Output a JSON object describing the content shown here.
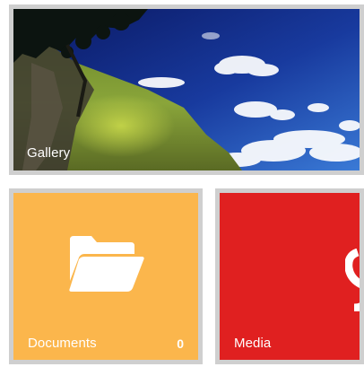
{
  "tiles": {
    "gallery": {
      "label": "Gallery"
    },
    "documents": {
      "label": "Documents",
      "count": "0"
    },
    "media": {
      "label": "Media"
    }
  },
  "colors": {
    "tile_border": "#cfcfcf",
    "documents_bg": "#fbb64c",
    "media_bg": "#e02020",
    "sky_dark": "#0a1a66",
    "sky_light": "#2a5fc0",
    "text": "#ffffff"
  },
  "icons": {
    "documents": "folder-open-icon",
    "media": "media-icon"
  }
}
